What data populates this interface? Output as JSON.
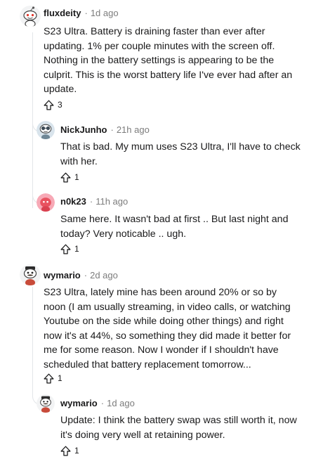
{
  "comments": [
    {
      "username": "fluxdeity",
      "separator": "·",
      "time": "1d ago",
      "body": "S23 Ultra. Battery is draining faster than ever after updating. 1% per couple minutes with the screen off. Nothing in the battery settings is appearing to be the culprit. This is the worst battery life I've ever had after an update.",
      "votes": "3",
      "avatar": "snoo-antenna-avatar"
    },
    {
      "username": "NickJunho",
      "separator": "·",
      "time": "21h ago",
      "body": "That is bad. My mum uses S23 Ultra, I'll have to check with her.",
      "votes": "1",
      "avatar": "snoo-goggles-avatar"
    },
    {
      "username": "n0k23",
      "separator": "·",
      "time": "11h ago",
      "body": "Same here. It wasn't bad at first .. But last night and today? Very noticable .. ugh.",
      "votes": "1",
      "avatar": "pink-snoo-avatar"
    },
    {
      "username": "wymario",
      "separator": "·",
      "time": "2d ago",
      "body": "S23 Ultra, lately mine has been around 20% or so by noon (I am usually streaming, in video calls, or watching Youtube on the side while doing other things) and right now it's at 44%, so something they did made it better for me for some reason. Now I wonder if I shouldn't have scheduled that battery replacement tomorrow...",
      "votes": "1",
      "avatar": "snoo-mustache-avatar"
    },
    {
      "username": "wymario",
      "separator": "·",
      "time": "1d ago",
      "body": "Update: I think the battery swap was still worth it, now it's doing very well at retaining power.",
      "votes": "1",
      "avatar": "snoo-mustache-avatar"
    }
  ],
  "icons": {
    "upvote": "upvote-arrow-icon"
  }
}
